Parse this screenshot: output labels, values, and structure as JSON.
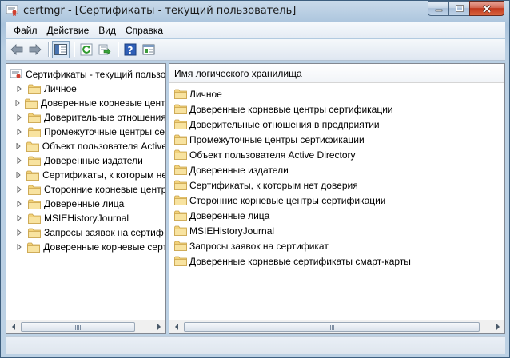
{
  "window": {
    "title": "certmgr - [Сертификаты - текущий пользователь]"
  },
  "menu": [
    "Файл",
    "Действие",
    "Вид",
    "Справка"
  ],
  "toolbar": {
    "buttons": [
      "back-arrow-icon",
      "forward-arrow-icon",
      "show-hide-tree-icon",
      "refresh-icon",
      "export-list-icon",
      "help-icon",
      "properties-icon"
    ]
  },
  "tree": {
    "root_label": "Сертификаты - текущий пользо",
    "items": [
      "Личное",
      "Доверенные корневые центр",
      "Доверительные отношения",
      "Промежуточные центры се",
      "Объект пользователя Active",
      "Доверенные издатели",
      "Сертификаты, к которым не",
      "Сторонние корневые центр",
      "Доверенные лица",
      "MSIEHistoryJournal",
      "Запросы заявок на сертиф",
      "Доверенные корневые серт"
    ]
  },
  "list": {
    "column_header": "Имя логического хранилища",
    "items": [
      "Личное",
      "Доверенные корневые центры сертификации",
      "Доверительные отношения в предприятии",
      "Промежуточные центры сертификации",
      "Объект пользователя Active Directory",
      "Доверенные издатели",
      "Сертификаты, к которым нет доверия",
      "Сторонние корневые центры сертификации",
      "Доверенные лица",
      "MSIEHistoryJournal",
      "Запросы заявок на сертификат",
      "Доверенные корневые сертификаты смарт-карты"
    ]
  },
  "colors": {
    "folder": "#f2d27a",
    "window_frame": "#a9c3dc",
    "close_button": "#c0381d"
  }
}
